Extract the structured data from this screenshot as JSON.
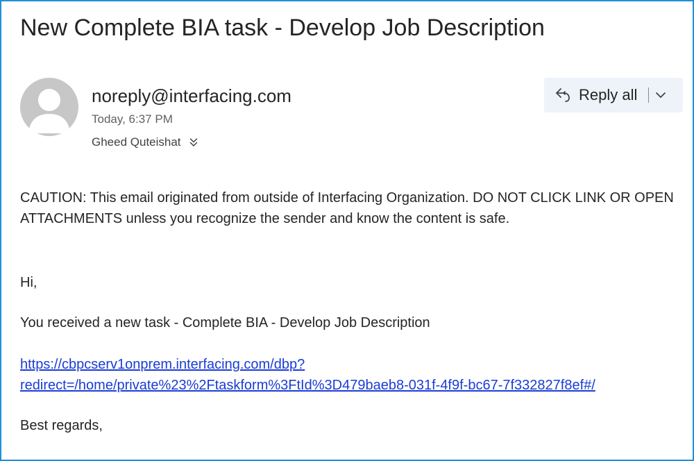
{
  "email": {
    "subject": "New Complete BIA task - Develop Job Description",
    "sender": "noreply@interfacing.com",
    "timestamp": "Today, 6:37 PM",
    "recipient": "Gheed Quteishat",
    "actions": {
      "reply_all_label": "Reply all"
    },
    "body": {
      "caution": "CAUTION: This email originated from outside of Interfacing Organization. DO NOT CLICK LINK OR OPEN ATTACHMENTS unless you recognize the sender and know the content is safe.",
      "greeting": "Hi,",
      "task_line": "You received a new task - Complete BIA - Develop Job Description",
      "link_line1": "https://cbpcserv1onprem.interfacing.com/dbp?",
      "link_line2": "redirect=/home/private%23%2Ftaskform%3FtId%3D479baeb8-031f-4f9f-bc67-7f332827f8ef#/",
      "signoff": "Best regards,"
    }
  },
  "icons": {
    "avatar": "person-silhouette-icon",
    "reply_all": "reply-all-icon",
    "dropdown": "chevron-down-icon",
    "expand_recipients": "double-chevron-down-icon"
  },
  "colors": {
    "frame_border": "#1e90d6",
    "link": "#1a3cd6",
    "reply_button_bg": "#eef3fa"
  }
}
